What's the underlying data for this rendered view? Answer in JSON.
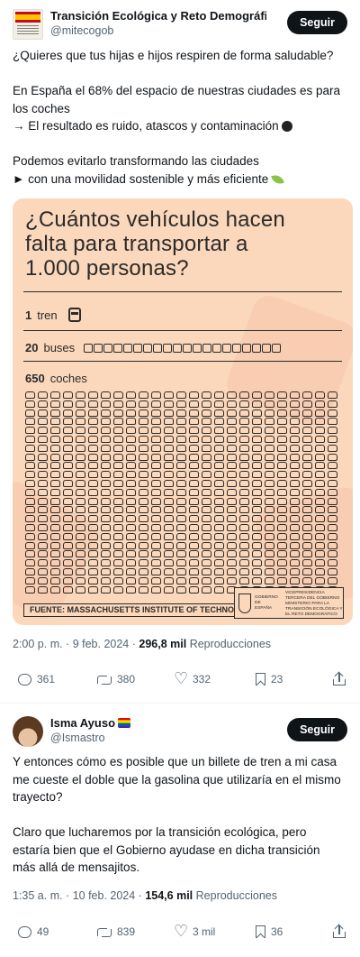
{
  "tweet1": {
    "display_name": "Transición Ecológica y Reto Demográfic",
    "handle": "@mitecogob",
    "follow_label": "Seguir",
    "paragraph1": "¿Quieres que tus hijas e hijos respiren de forma saludable?",
    "paragraph2_line1": "En España el 68% del espacio de nuestras ciudades es para",
    "paragraph2_line2": "los coches",
    "paragraph2_line3": "→ El resultado es ruido, atascos y contaminación",
    "paragraph3_line1": "Podemos evitarlo transformando las ciudades",
    "paragraph3_line2": "► con una movilidad sostenible y más eficiente",
    "infographic": {
      "title_line1": "¿Cuántos vehículos hacen",
      "title_line2": "falta para transportar a",
      "title_line3": "1.000 personas?",
      "train_count": "1",
      "train_label": "tren",
      "bus_count": "20",
      "bus_label": "buses",
      "car_count": "650",
      "car_label": "coches",
      "source": "FUENTE: MASSACHUSETTS INSTITUTE OF TECHNOLOGY",
      "gov_a": "GOBIERNO DE ESPAÑA",
      "gov_b": "VICEPRESIDENCIA TERCERA DEL GOBIERNO MINISTERIO PARA LA TRANSICIÓN ECOLÓGICA Y EL RETO DEMOGRÁFICO"
    },
    "time": "2:00 p. m. · 9 feb. 2024 ·",
    "views_count": "296,8 mil",
    "views_label": "Reproducciones",
    "replies": "361",
    "retweets": "380",
    "likes": "332",
    "bookmarks": "23"
  },
  "tweet2": {
    "display_name": "Isma Ayuso",
    "handle": "@Ismastro",
    "follow_label": "Seguir",
    "p1_line1": "Y entonces cómo es posible que un billete de tren a mi casa",
    "p1_line2": "me cueste el doble que la gasolina que utilizaría en el mismo",
    "p1_line3": "trayecto?",
    "p2_line1": "Claro que lucharemos por la transición ecológica, pero",
    "p2_line2": "estaría bien que el Gobierno ayudase en dicha transición",
    "p2_line3": "más allá de mensajitos.",
    "time": "1:35 a. m. · 10 feb. 2024 ·",
    "views_count": "154,6 mil",
    "views_label": "Reproducciones",
    "replies": "49",
    "retweets": "839",
    "likes": "3 mil",
    "bookmarks": "36"
  },
  "colors": {
    "infographic_bg": "#fbd7bb",
    "follow_bg": "#0f1419",
    "secondary_text": "#536471"
  },
  "icons": [
    "verified-badge-icon",
    "rainbow-flag-icon",
    "reply-icon",
    "retweet-icon",
    "like-icon",
    "bookmark-icon",
    "share-icon",
    "train-icon",
    "bus-icon",
    "car-icon"
  ]
}
